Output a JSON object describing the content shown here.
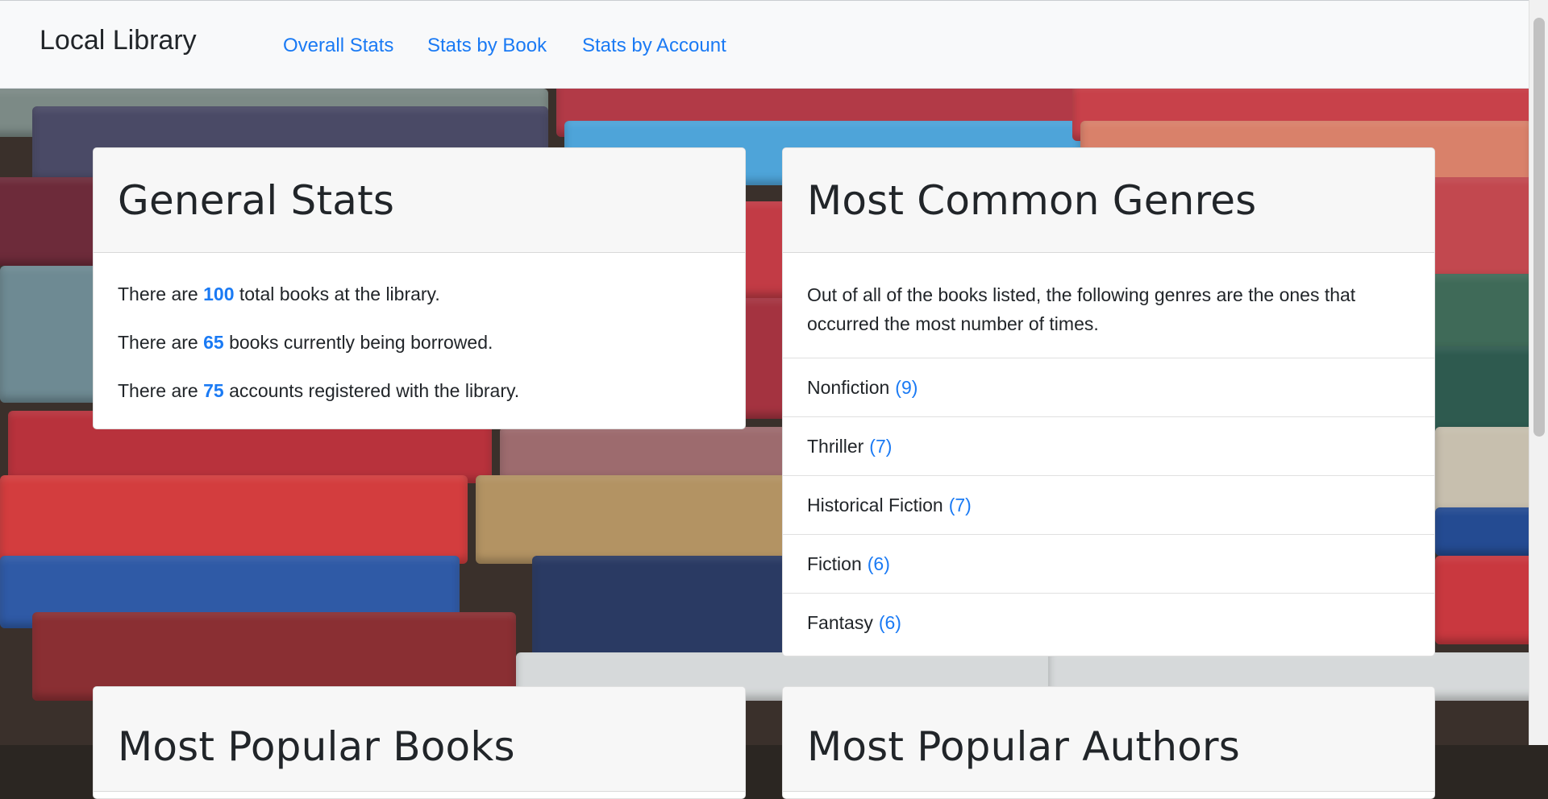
{
  "nav": {
    "brand": "Local Library",
    "links": [
      "Overall Stats",
      "Stats by Book",
      "Stats by Account"
    ]
  },
  "general_stats": {
    "title": "General Stats",
    "total_books": {
      "prefix": "There are ",
      "value": "100",
      "suffix": " total books at the library."
    },
    "borrowed": {
      "prefix": "There are ",
      "value": "65",
      "suffix": " books currently being borrowed."
    },
    "accounts": {
      "prefix": "There are ",
      "value": "75",
      "suffix": " accounts registered with the library."
    }
  },
  "genres": {
    "title": "Most Common Genres",
    "intro": "Out of all of the books listed, the following genres are the ones that occurred the most number of times.",
    "items": [
      {
        "name": "Nonfiction",
        "count": "(9)"
      },
      {
        "name": "Thriller",
        "count": "(7)"
      },
      {
        "name": "Historical Fiction",
        "count": "(7)"
      },
      {
        "name": "Fiction",
        "count": "(6)"
      },
      {
        "name": "Fantasy",
        "count": "(6)"
      }
    ]
  },
  "popular_books": {
    "title": "Most Popular Books"
  },
  "popular_authors": {
    "title": "Most Popular Authors"
  },
  "colors": {
    "accent": "#1a7af4",
    "navbar_bg": "#f8f9fa",
    "text": "#212529"
  }
}
